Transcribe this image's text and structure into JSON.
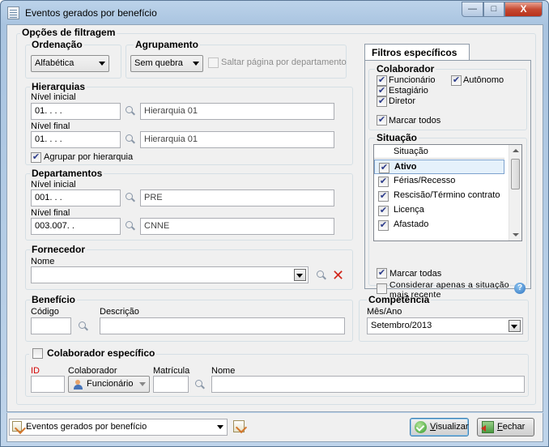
{
  "window": {
    "title": "Eventos gerados por benefício",
    "minimize_glyph": "—",
    "maximize_glyph": "□",
    "close_glyph": "X"
  },
  "filter_options": {
    "title": "Opções de filtragem",
    "ordering": {
      "label": "Ordenação",
      "value": "Alfabética"
    },
    "grouping": {
      "label": "Agrupamento",
      "value": "Sem quebra",
      "page_break_label": "Saltar página por departamento",
      "page_break_checked": false
    },
    "hierarchies": {
      "label": "Hierarquias",
      "start_label": "Nível inicial",
      "start_code": "01.   .   .   .",
      "start_name": "Hierarquia 01",
      "end_label": "Nível final",
      "end_code": "01.   .   .   .",
      "end_name": "Hierarquia 01",
      "group_label": "Agrupar por hierarquia",
      "group_checked": true
    },
    "departments": {
      "label": "Departamentos",
      "start_label": "Nível inicial",
      "start_code": "001.   .   .",
      "start_name": "PRE",
      "end_label": "Nível final",
      "end_code": "003.007.   .",
      "end_name": "CNNE"
    },
    "supplier": {
      "label": "Fornecedor",
      "name_label": "Nome",
      "name_value": ""
    },
    "benefit": {
      "label": "Benefício",
      "code_label": "Código",
      "code_value": "",
      "description_label": "Descrição",
      "description_value": ""
    },
    "competence": {
      "label": "Competência",
      "month_year_label": "Mês/Ano",
      "value": "Setembro/2013"
    },
    "specific_employee": {
      "label": "Colaborador específico",
      "checked": false,
      "id_label": "ID",
      "id_value": "",
      "employee_label": "Colaborador",
      "employee_type": "Funcionário",
      "registration_label": "Matrícula",
      "registration_value": "",
      "name_label": "Nome",
      "name_value": ""
    }
  },
  "specific_filters": {
    "tab_label": "Filtros específicos",
    "employee": {
      "label": "Colaborador",
      "options": [
        {
          "label": "Funcionário",
          "checked": true
        },
        {
          "label": "Autônomo",
          "checked": true
        },
        {
          "label": "Estagiário",
          "checked": true
        },
        {
          "label": "Diretor",
          "checked": true
        }
      ],
      "mark_all_label": "Marcar todos",
      "mark_all_checked": true
    },
    "situation": {
      "label": "Situação",
      "column_header": "Situação",
      "rows": [
        {
          "label": "Ativo",
          "checked": true
        },
        {
          "label": "Férias/Recesso",
          "checked": true
        },
        {
          "label": "Rescisão/Término contrato",
          "checked": true
        },
        {
          "label": "Licença",
          "checked": true
        },
        {
          "label": "Afastado",
          "checked": true
        }
      ],
      "mark_all_label": "Marcar todas",
      "mark_all_checked": true,
      "latest_only_label_1": "Considerar apenas a situação",
      "latest_only_label_2": "mais recente",
      "latest_only_checked": false
    }
  },
  "bottom": {
    "report_select": "Eventos gerados por benefício",
    "view_button_prefix": "",
    "view_button_hotkey": "V",
    "view_button_rest": "isualizar",
    "close_button_hotkey": "F",
    "close_button_rest": "echar"
  },
  "check_glyph": "✔"
}
